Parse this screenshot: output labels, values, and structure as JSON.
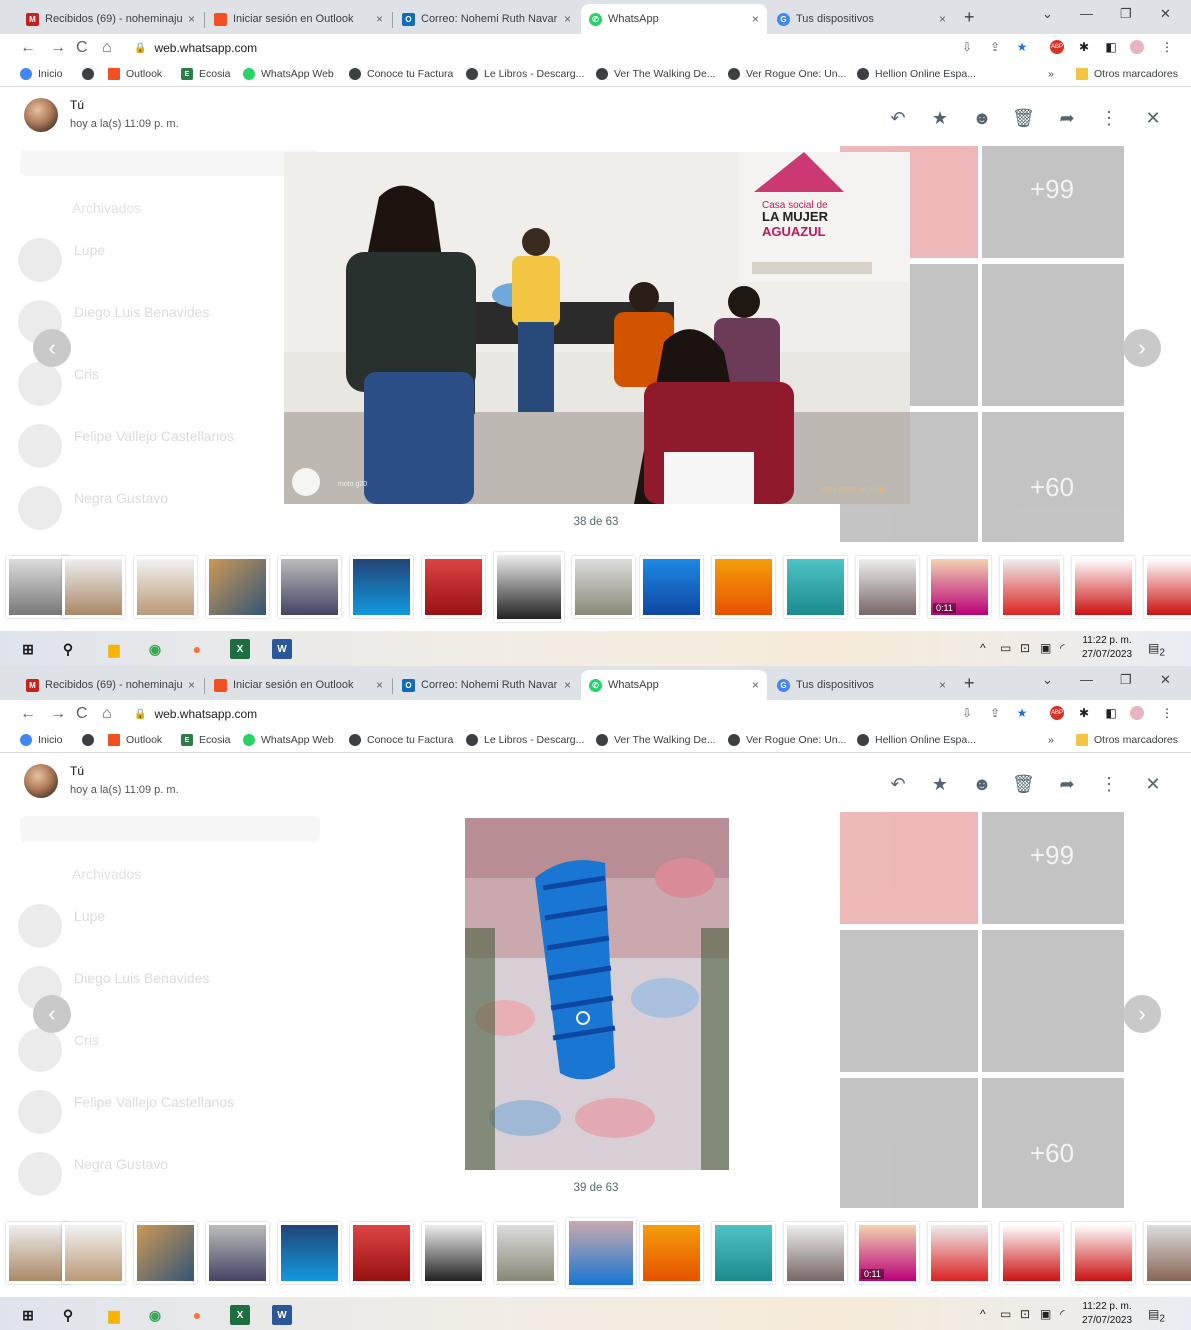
{
  "browser": {
    "tabs": [
      {
        "label": "Recibidos (69) - noheminaju",
        "color": "#c5221f",
        "glyph": "M"
      },
      {
        "label": "Iniciar sesión en Outlook",
        "color": "#f25022",
        "glyph": "■"
      },
      {
        "label": "Correo: Nohemi Ruth Navarr",
        "color": "#0f6cbd",
        "glyph": "O"
      },
      {
        "label": "WhatsApp",
        "color": "#25d366",
        "glyph": "✆"
      },
      {
        "label": "Tus dispositivos",
        "color": "#4285f4",
        "glyph": "G"
      }
    ],
    "active_tab_index": 3,
    "url": "web.whatsapp.com",
    "bookmarks": [
      {
        "label": "Inicio",
        "color": "#4285f4"
      },
      {
        "label": "",
        "color": "#5f6368"
      },
      {
        "label": "Outlook",
        "color": "#f25022"
      },
      {
        "label": "Ecosia",
        "color": "#2d7d46"
      },
      {
        "label": "WhatsApp Web",
        "color": "#25d366"
      },
      {
        "label": "Conoce tu Factura",
        "color": "#5f6368"
      },
      {
        "label": "Le Libros - Descarg...",
        "color": "#5f6368"
      },
      {
        "label": "Ver The Walking De...",
        "color": "#5f6368"
      },
      {
        "label": "Ver Rogue One: Un...",
        "color": "#5f6368"
      },
      {
        "label": "Hellion Online Espa...",
        "color": "#5f6368"
      }
    ],
    "bookmarks_more": "»",
    "other_bookmarks": "Otros marcadores"
  },
  "viewer": {
    "sender_name": "Tú",
    "sender_time": "hoy a la(s) 11:09 p. m.",
    "background_chats": [
      "Lupe",
      "Diego Luis Benavides",
      "Cris",
      "Felipe Vallejo Castellanos",
      "Negra Gustavo"
    ],
    "background_archived": "Archivados",
    "background_badges": [
      "+99",
      "+60"
    ]
  },
  "screens": [
    {
      "counter": "38 de 63",
      "photo_caption": "moto g20",
      "photo_stamp": "2023-07-27 18:33:18",
      "sign_line1": "Casa social de",
      "sign_line2": "LA MUJER",
      "sign_line3": "AGUAZUL"
    },
    {
      "counter": "39 de 63"
    }
  ],
  "thumbnails": {
    "video_duration": "0:11"
  },
  "taskbar": {
    "time": "11:22 p. m.",
    "date": "27/07/2023",
    "notifications": "2"
  }
}
